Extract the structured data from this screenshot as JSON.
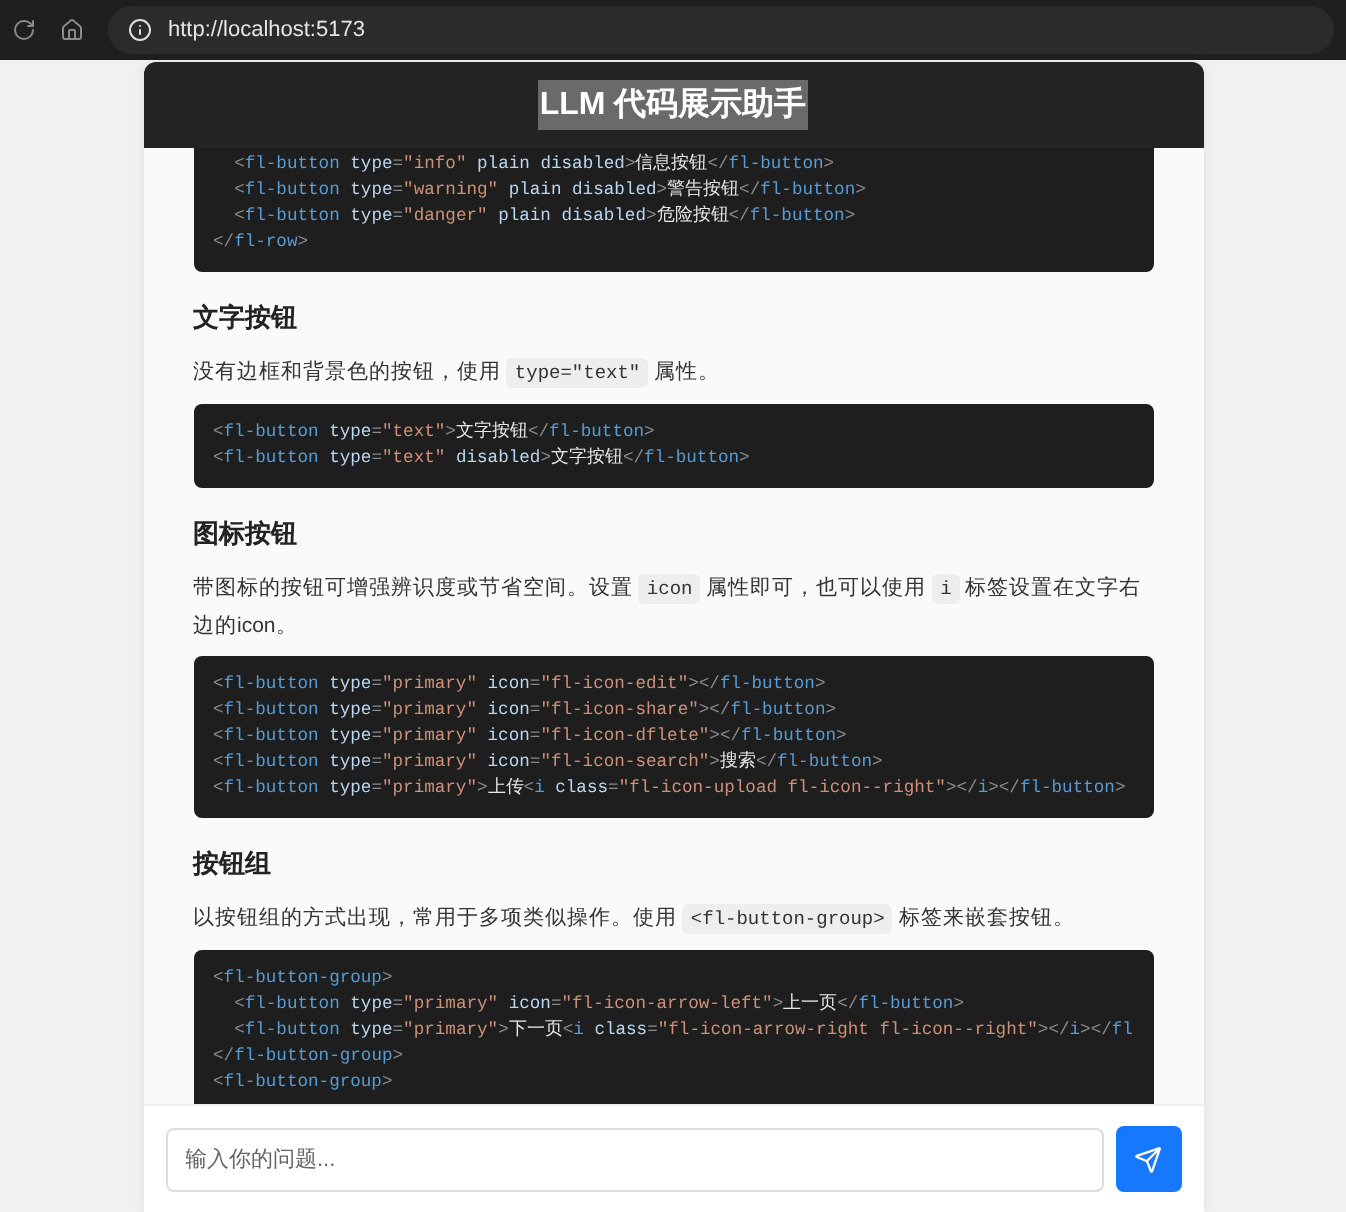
{
  "browser": {
    "url": "http://localhost:5173"
  },
  "app": {
    "title": "LLM 代码展示助手"
  },
  "sections": [
    {
      "kind": "code",
      "lines": [
        "  <fl-button type=\"info\" plain disabled>信息按钮</fl-button>",
        "  <fl-button type=\"warning\" plain disabled>警告按钮</fl-button>",
        "  <fl-button type=\"danger\" plain disabled>危险按钮</fl-button>",
        "</fl-row>"
      ]
    },
    {
      "kind": "heading",
      "text": "文字按钮"
    },
    {
      "kind": "paragraph",
      "parts": [
        {
          "kind": "text",
          "s": "没有边框和背景色的按钮，使用 "
        },
        {
          "kind": "code",
          "s": "type=\"text\""
        },
        {
          "kind": "text",
          "s": " 属性。"
        }
      ]
    },
    {
      "kind": "code",
      "lines": [
        "<fl-button type=\"text\">文字按钮</fl-button>",
        "<fl-button type=\"text\" disabled>文字按钮</fl-button>"
      ]
    },
    {
      "kind": "heading",
      "text": "图标按钮"
    },
    {
      "kind": "paragraph",
      "parts": [
        {
          "kind": "text",
          "s": "带图标的按钮可增强辨识度或节省空间。设置 "
        },
        {
          "kind": "code",
          "s": "icon"
        },
        {
          "kind": "text",
          "s": " 属性即可，也可以使用 "
        },
        {
          "kind": "code",
          "s": "i"
        },
        {
          "kind": "text",
          "s": " 标签设置在文字右边的icon。"
        }
      ]
    },
    {
      "kind": "code",
      "lines": [
        "<fl-button type=\"primary\" icon=\"fl-icon-edit\"></fl-button>",
        "<fl-button type=\"primary\" icon=\"fl-icon-share\"></fl-button>",
        "<fl-button type=\"primary\" icon=\"fl-icon-dflete\"></fl-button>",
        "<fl-button type=\"primary\" icon=\"fl-icon-search\">搜索</fl-button>",
        "<fl-button type=\"primary\">上传<i class=\"fl-icon-upload fl-icon--right\"></i></fl-button>"
      ]
    },
    {
      "kind": "heading",
      "text": "按钮组"
    },
    {
      "kind": "paragraph",
      "parts": [
        {
          "kind": "text",
          "s": "以按钮组的方式出现，常用于多项类似操作。使用 "
        },
        {
          "kind": "code",
          "s": "<fl-button-group>"
        },
        {
          "kind": "text",
          "s": " 标签来嵌套按钮。"
        }
      ]
    },
    {
      "kind": "code",
      "lines": [
        "<fl-button-group>",
        "  <fl-button type=\"primary\" icon=\"fl-icon-arrow-left\">上一页</fl-button>",
        "  <fl-button type=\"primary\">下一页<i class=\"fl-icon-arrow-right fl-icon--right\"></i></fl",
        "</fl-button-group>",
        "<fl-button-group>"
      ]
    }
  ],
  "composer": {
    "placeholder": "输入你的问题..."
  }
}
